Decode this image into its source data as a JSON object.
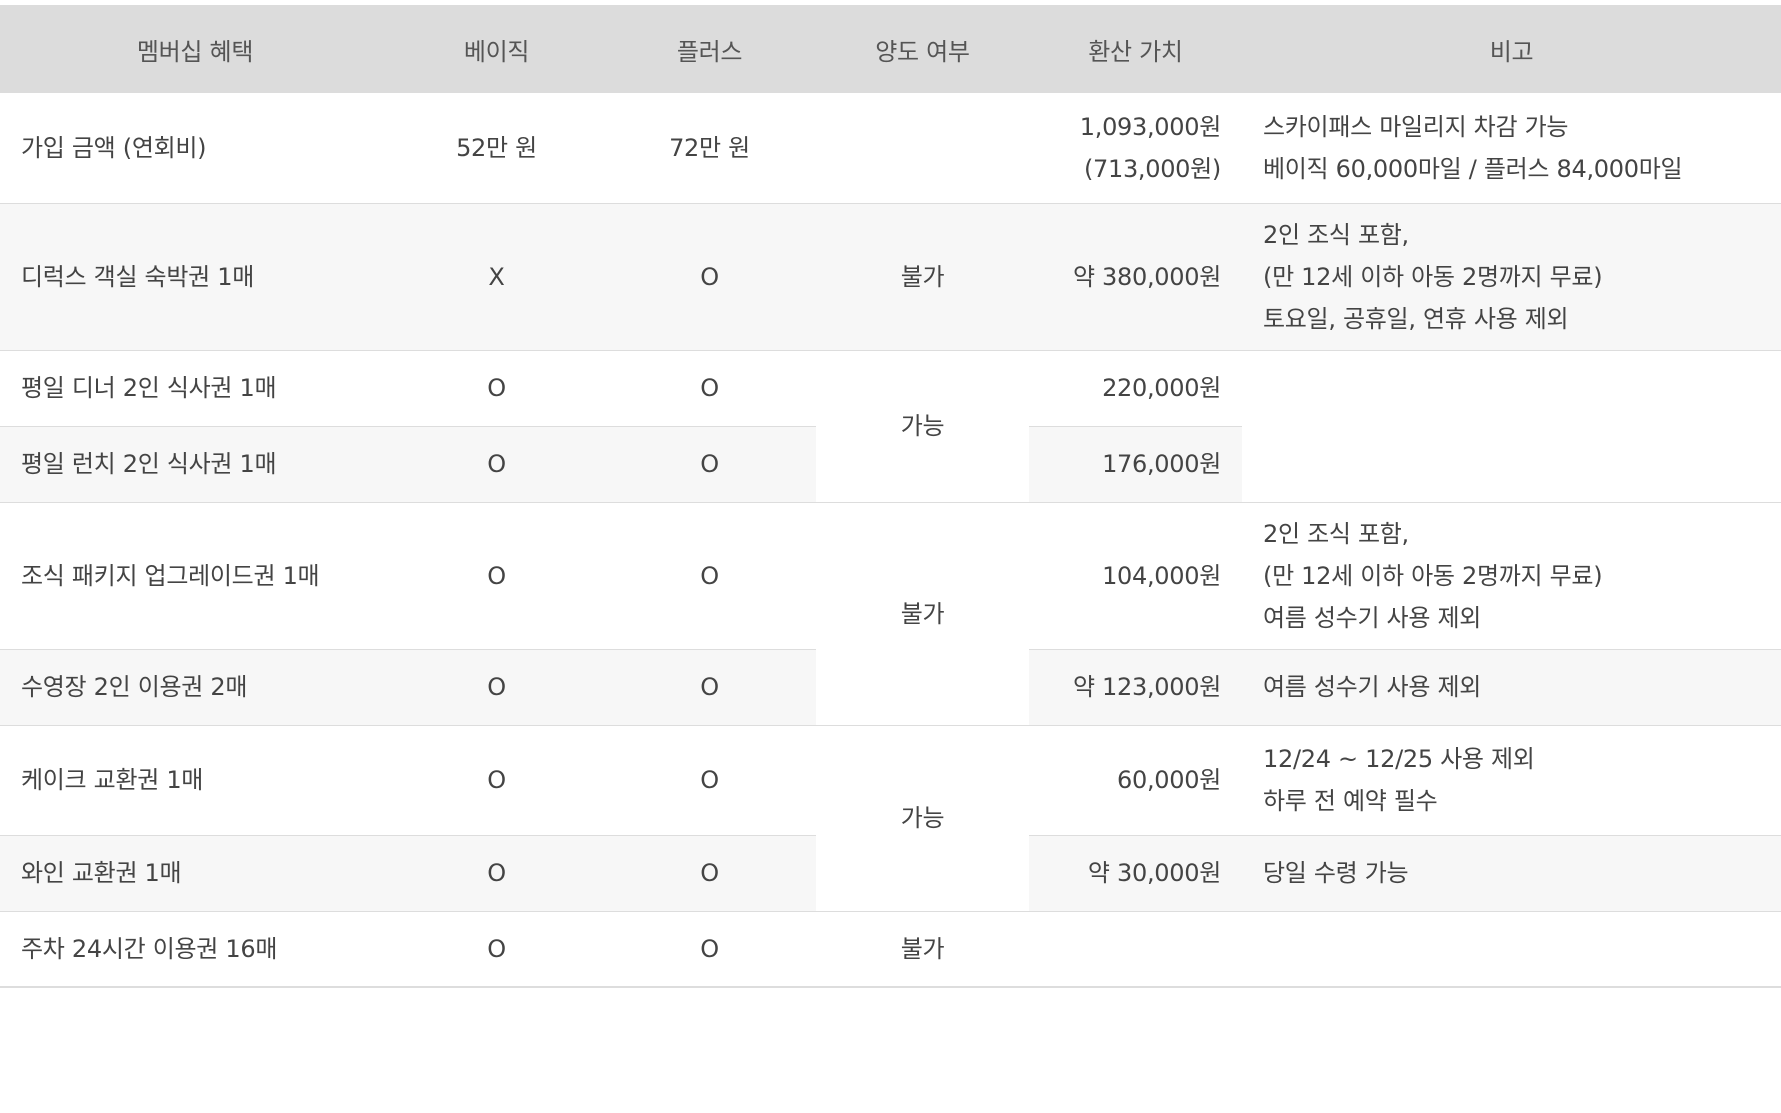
{
  "headers": [
    "멤버십 혜택",
    "베이직",
    "플러스",
    "양도 여부",
    "환산 가치",
    "비고"
  ],
  "rows": [
    {
      "name": "가입 금액 (연회비)",
      "basic": "52만 원",
      "plus": "72만 원",
      "transfer": "",
      "value": [
        "1,093,000원",
        "(713,000원)"
      ],
      "note": [
        "스카이패스 마일리지 차감 가능",
        "베이직 60,000마일 / 플러스 84,000마일"
      ]
    },
    {
      "name": "디럭스 객실 숙박권 1매",
      "basic": "X",
      "plus": "O",
      "transfer": "불가",
      "value": [
        "약 380,000원"
      ],
      "note": [
        "2인 조식 포함,",
        "(만 12세 이하 아동 2명까지 무료)",
        "토요일, 공휴일, 연휴 사용 제외"
      ]
    },
    {
      "name": "평일 디너 2인 식사권 1매",
      "basic": "O",
      "plus": "O",
      "transfer": "가능",
      "value": [
        "220,000원"
      ],
      "note": []
    },
    {
      "name": "평일 런치 2인 식사권 1매",
      "basic": "O",
      "plus": "O",
      "value": [
        "176,000원"
      ]
    },
    {
      "name": "조식 패키지 업그레이드권 1매",
      "basic": "O",
      "plus": "O",
      "transfer": "불가",
      "value": [
        "104,000원"
      ],
      "note": [
        "2인 조식 포함,",
        "(만 12세 이하 아동 2명까지 무료)",
        "여름 성수기 사용 제외"
      ]
    },
    {
      "name": "수영장 2인 이용권 2매",
      "basic": "O",
      "plus": "O",
      "value": [
        "약 123,000원"
      ],
      "note": [
        "여름 성수기 사용 제외"
      ]
    },
    {
      "name": "케이크 교환권 1매",
      "basic": "O",
      "plus": "O",
      "transfer": "가능",
      "value": [
        "60,000원"
      ],
      "note": [
        "12/24 ~ 12/25 사용 제외",
        "하루 전 예약 필수"
      ]
    },
    {
      "name": "와인 교환권 1매",
      "basic": "O",
      "plus": "O",
      "value": [
        "약 30,000원"
      ],
      "note": [
        "당일 수령 가능"
      ]
    },
    {
      "name": "주차 24시간 이용권 16매",
      "basic": "O",
      "plus": "O",
      "transfer": "불가",
      "value": [],
      "note": []
    }
  ]
}
